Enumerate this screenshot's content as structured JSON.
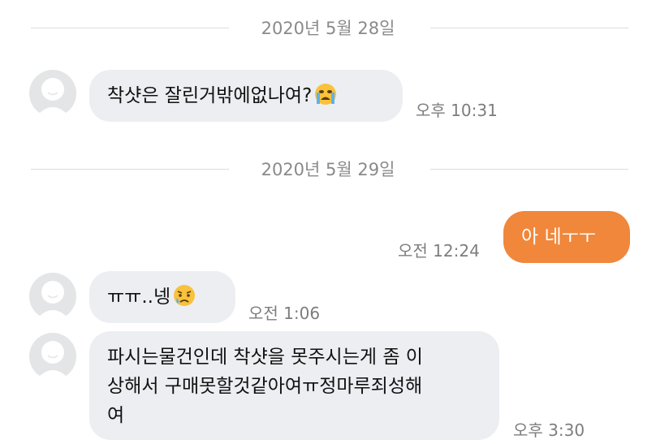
{
  "dates": [
    "2020년 5월 28일",
    "2020년 5월 29일"
  ],
  "messages": [
    {
      "text": "착샷은 잘린거밖에없나여?",
      "emoji": "crying-face-emoji",
      "time": "오후 10:31"
    },
    {
      "text": "아 네ㅜㅜ",
      "time": "오전 12:24"
    },
    {
      "text": "ㅠㅠ..넹",
      "emoji": "sad-relieved-face-emoji",
      "time": "오전 1:06"
    },
    {
      "lines": [
        "파시는물건인데 착샷을 못주시는게 좀 이",
        "상해서 구매못할것같아여ㅠ정마루죄성해",
        "여"
      ],
      "time": "오후 3:30"
    }
  ],
  "colors": {
    "my_bubble": "#f0873b",
    "their_bubble": "#eceef1",
    "timestamp": "#7d7d7d"
  }
}
